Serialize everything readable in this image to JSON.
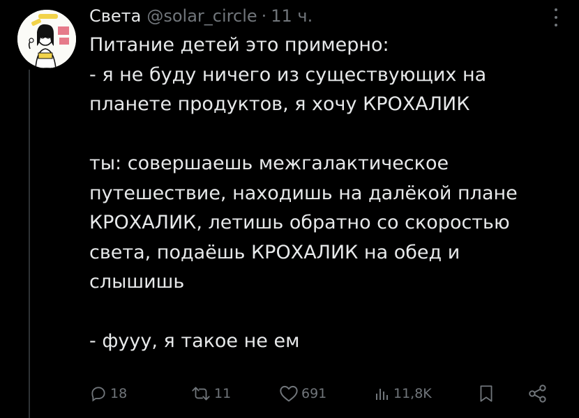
{
  "post": {
    "display_name": "Света",
    "handle": "@solar_circle",
    "separator": "·",
    "time": "11 ч.",
    "text": "Питание детей это примерно:\n- я не буду ничего из существующих на\nпланете продуктов, я хочу КРОХАЛИК\n\nты: совершаешь межгалактическое\nпутешествие, находишь на далёкой плане\nКРОХАЛИК, летишь обратно со скоростью\nсвета, подаёшь КРОХАЛИК на обед и\nслышишь\n\n- фууу, я такое не ем"
  },
  "actions": {
    "replies": "18",
    "reposts": "11",
    "likes": "691",
    "views": "11,8K"
  },
  "icons": {
    "more": "more-vertical-icon",
    "reply": "reply-icon",
    "repost": "repost-icon",
    "like": "heart-icon",
    "views": "views-icon",
    "bookmark": "bookmark-icon",
    "share": "share-icon"
  },
  "colors": {
    "background": "#000000",
    "text": "#e7e9ea",
    "muted": "#71767b"
  }
}
